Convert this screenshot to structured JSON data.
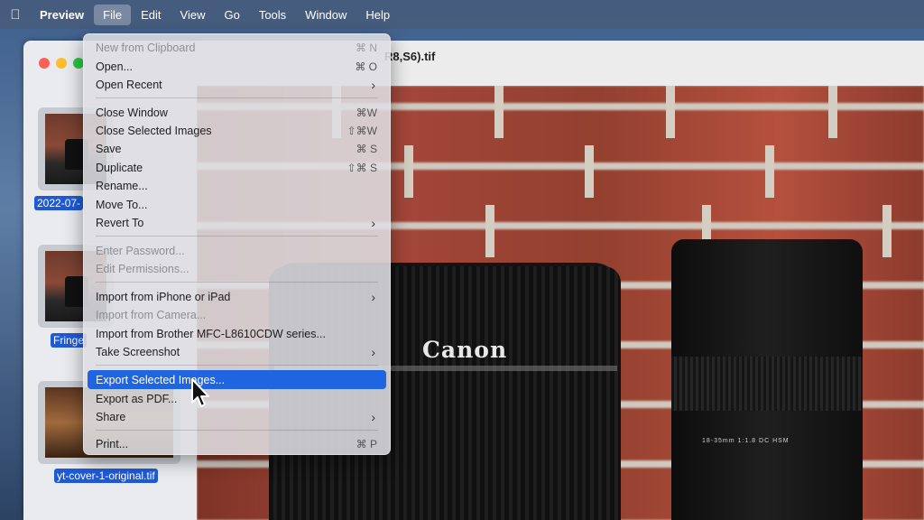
{
  "menubar": {
    "apple_icon": "apple-logo-icon",
    "app_name": "Preview",
    "items": [
      "File",
      "Edit",
      "View",
      "Go",
      "Tools",
      "Window",
      "Help"
    ]
  },
  "window": {
    "title": "R8,S6).tif"
  },
  "sidebar": {
    "thumbnails": [
      {
        "label": "2022-07-"
      },
      {
        "label": "Fringe"
      },
      {
        "label": "yt-cover-1-original.tif"
      }
    ]
  },
  "photo": {
    "brand_text": "Canon",
    "lens_scale_text": "18-35mm 1:1.8 DC HSM"
  },
  "file_menu": {
    "items": [
      {
        "label": "New from Clipboard",
        "shortcut": "⌘ N",
        "disabled": true
      },
      {
        "label": "Open...",
        "shortcut": "⌘ O"
      },
      {
        "label": "Open Recent",
        "submenu": true
      },
      {
        "label": "Close Window",
        "shortcut": "⌘W"
      },
      {
        "label": "Close Selected Images",
        "shortcut": "⇧⌘W"
      },
      {
        "label": "Save",
        "shortcut": "⌘ S"
      },
      {
        "label": "Duplicate",
        "shortcut": "⇧⌘ S"
      },
      {
        "label": "Rename..."
      },
      {
        "label": "Move To..."
      },
      {
        "label": "Revert To",
        "submenu": true
      },
      {
        "label": "Enter Password...",
        "disabled": true
      },
      {
        "label": "Edit Permissions...",
        "disabled": true
      },
      {
        "label": "Import from iPhone or iPad",
        "submenu": true
      },
      {
        "label": "Import from Camera...",
        "disabled": true
      },
      {
        "label": "Import from Brother MFC-L8610CDW series..."
      },
      {
        "label": "Take Screenshot",
        "submenu": true
      },
      {
        "label": "Export Selected Images...",
        "highlighted": true
      },
      {
        "label": "Export as PDF..."
      },
      {
        "label": "Share",
        "submenu": true
      },
      {
        "label": "Print...",
        "shortcut": "⌘ P"
      }
    ]
  }
}
